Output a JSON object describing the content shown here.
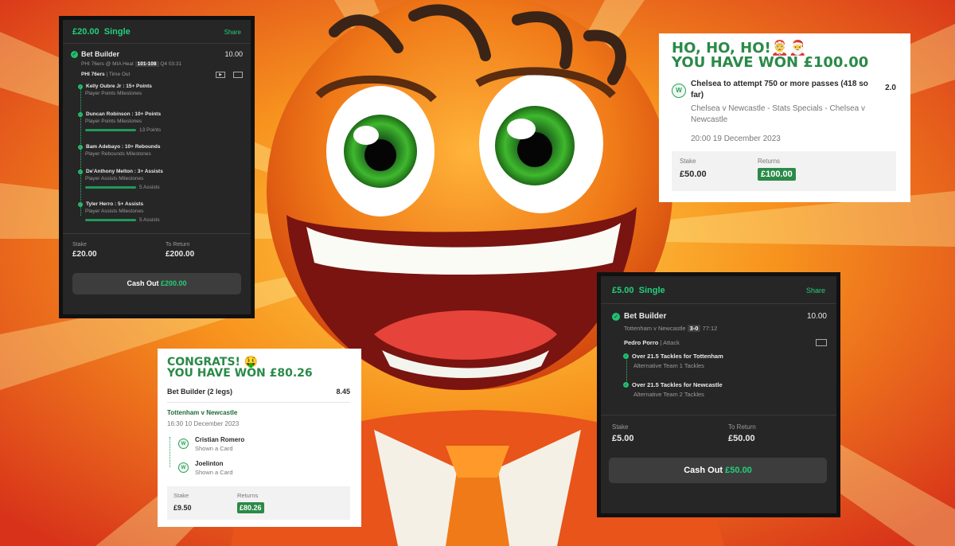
{
  "card1": {
    "stake_header": "£20.00",
    "type": "Single",
    "share": "Share",
    "market": "Bet Builder",
    "odds": "10.00",
    "match": "PHI 76ers @ MIA Heat",
    "score": "101-108",
    "time": "Q4  03:31",
    "team": "PHI 76ers",
    "status": "Time Out",
    "legs": [
      {
        "title": "Kelly Oubre Jr : 15+ Points",
        "sub": "Player Points Milestones",
        "progress": ""
      },
      {
        "title": "Duncan Robinson : 10+ Points",
        "sub": "Player Points Milestones",
        "progress": "13 Points"
      },
      {
        "title": "Bam Adebayo : 10+ Rebounds",
        "sub": "Player Rebounds Milestones",
        "progress": ""
      },
      {
        "title": "De'Anthony Melton : 3+ Assists",
        "sub": "Player Assists Milestones",
        "progress": "5 Assists"
      },
      {
        "title": "Tyler Herro : 5+ Assists",
        "sub": "Player Assists Milestones",
        "progress": "5 Assists"
      }
    ],
    "stake_label": "Stake",
    "stake": "£20.00",
    "return_label": "To Return",
    "return": "£200.00",
    "cashout_label": "Cash Out",
    "cashout_value": "£200.00"
  },
  "card2": {
    "banner1": "HO, HO, HO!🤶🎅",
    "banner2": "YOU HAVE WON £100.00",
    "selection": "Chelsea to attempt 750 or more passes (418 so far)",
    "odds": "2.0",
    "event": "Chelsea v Newcastle - Stats Specials - Chelsea v Newcastle",
    "datetime": "20:00 19 December 2023",
    "stake_label": "Stake",
    "stake": "£50.00",
    "returns_label": "Returns",
    "returns": "£100.00",
    "w": "W"
  },
  "card3": {
    "banner1": "CONGRATS! 🤑",
    "banner2": "YOU HAVE WON £80.26",
    "market": "Bet Builder (2 legs)",
    "odds": "8.45",
    "match": "Tottenham v Newcastle",
    "datetime": "16:30 10 December 2023",
    "legs": [
      {
        "name": "Cristian Romero",
        "sub": "Shown a Card"
      },
      {
        "name": "Joelinton",
        "sub": "Shown a Card"
      }
    ],
    "stake_label": "Stake",
    "stake": "£9.50",
    "returns_label": "Returns",
    "returns": "£80.26",
    "w": "W"
  },
  "card4": {
    "stake_header": "£5.00",
    "type": "Single",
    "share": "Share",
    "market": "Bet Builder",
    "odds": "10.00",
    "match": "Tottenham v Newcastle",
    "score": "3-0",
    "time": "77:12",
    "player": "Pedro Porro",
    "position": "Attack",
    "legs": [
      {
        "title": "Over 21.5 Tackles for Tottenham",
        "sub": "Alternative Team 1 Tackles"
      },
      {
        "title": "Over 21.5 Tackles for Newcastle",
        "sub": "Alternative Team 2 Tackles"
      }
    ],
    "stake_label": "Stake",
    "stake": "£5.00",
    "return_label": "To Return",
    "return": "£50.00",
    "cashout_label": "Cash Out",
    "cashout_value": "£50.00"
  }
}
